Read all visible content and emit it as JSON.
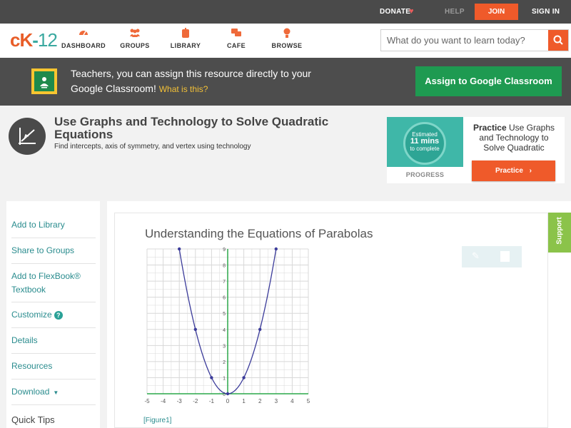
{
  "topbar": {
    "donate": "DONATE",
    "help": "HELP",
    "join": "JOIN",
    "signin": "SIGN IN"
  },
  "nav": {
    "logo_ck": "cK",
    "logo_dash": "-",
    "logo_num": "12",
    "items": [
      {
        "label": "DASHBOARD",
        "icon": "dashboard-icon"
      },
      {
        "label": "GROUPS",
        "icon": "groups-icon"
      },
      {
        "label": "LIBRARY",
        "icon": "library-icon"
      },
      {
        "label": "CAFE",
        "icon": "cafe-icon"
      },
      {
        "label": "BROWSE",
        "icon": "browse-icon"
      }
    ],
    "search_placeholder": "What do you want to learn today?"
  },
  "banner": {
    "message": "Teachers, you can assign this resource directly to your Google Classroom!",
    "what_link": "What is this?",
    "assign_button": "Assign to Google Classroom"
  },
  "header": {
    "title": "Use Graphs and Technology to Solve Quadratic Equations",
    "subtitle": "Find intercepts, axis of symmetry, and vertex using technology"
  },
  "practice": {
    "estimated": "Estimated",
    "mins": "11 mins",
    "to_complete": "to complete",
    "progress_label": "PROGRESS",
    "practice_bold": "Practice",
    "practice_text": "Use Graphs and Technology to Solve Quadratic",
    "button": "Practice"
  },
  "sidebar": {
    "items": [
      {
        "label": "Add to Library"
      },
      {
        "label": "Share to Groups"
      },
      {
        "label": "Add to FlexBook® Textbook"
      },
      {
        "label": "Customize"
      },
      {
        "label": "Details"
      },
      {
        "label": "Resources"
      },
      {
        "label": "Download"
      }
    ],
    "help_mark": "?",
    "quick_tips": "Quick Tips"
  },
  "content": {
    "section_title": "Understanding the Equations of Parabolas",
    "figure_link": "[Figure1]"
  },
  "support_tab": "Support",
  "chart_data": {
    "type": "line",
    "function": "y = x^2",
    "x": [
      -3,
      -2,
      -1,
      0,
      1,
      2,
      3
    ],
    "y": [
      9,
      4,
      1,
      0,
      1,
      4,
      9
    ],
    "xlim": [
      -5,
      5
    ],
    "ylim": [
      0,
      9
    ],
    "x_ticks": [
      "-5",
      "-4",
      "-3",
      "-2",
      "-1",
      "0",
      "1",
      "2",
      "3",
      "4",
      "5"
    ],
    "y_ticks": [
      "0",
      "1",
      "2",
      "3",
      "4",
      "5",
      "6",
      "7",
      "8",
      "9"
    ],
    "grid": true,
    "line_color": "#3b3b9a",
    "axis_color": "#2aa84a"
  },
  "colors": {
    "accent_orange": "#ef5a2a",
    "teal_link": "#2a8c8e",
    "google_green": "#1e9a51"
  }
}
